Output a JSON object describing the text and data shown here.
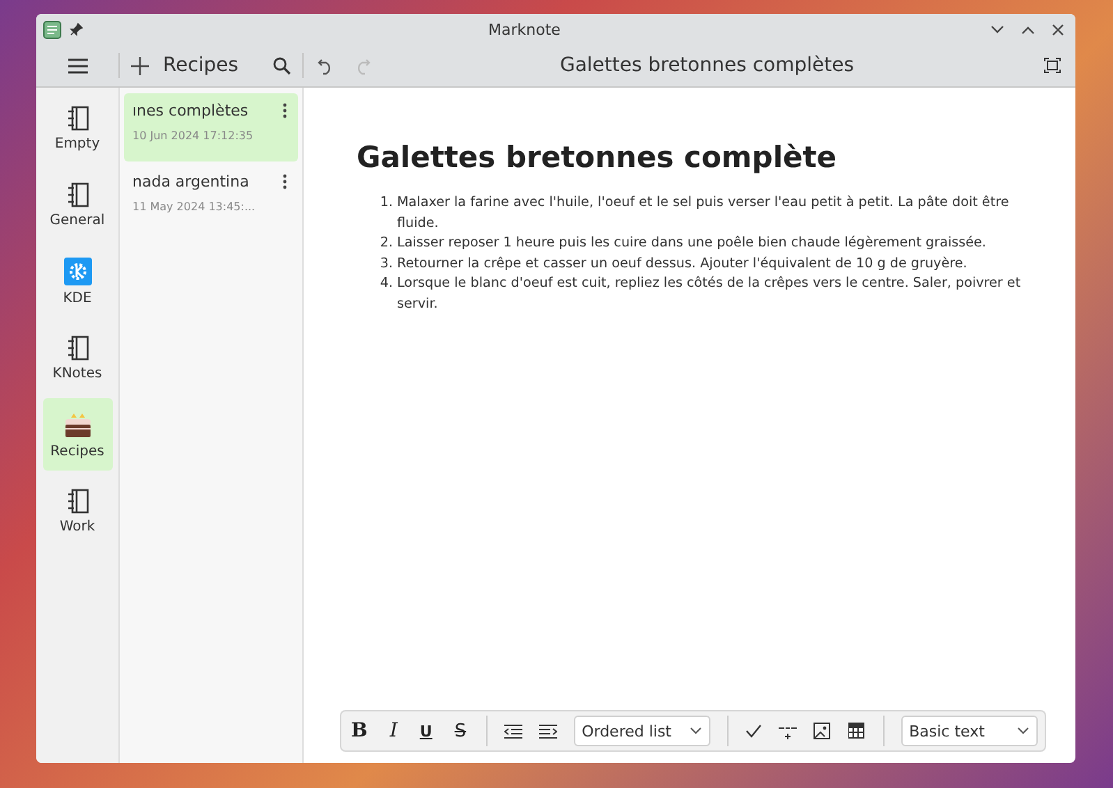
{
  "window": {
    "title": "Marknote"
  },
  "header": {
    "notebook_title": "Recipes",
    "note_title": "Galettes bretonnes complètes"
  },
  "notebooks": [
    {
      "name": "Empty",
      "kind": "notebook",
      "selected": false
    },
    {
      "name": "General",
      "kind": "notebook",
      "selected": false
    },
    {
      "name": "KDE",
      "kind": "kde",
      "selected": false
    },
    {
      "name": "KNotes",
      "kind": "notebook",
      "selected": false
    },
    {
      "name": "Recipes",
      "kind": "cake",
      "selected": true
    },
    {
      "name": "Work",
      "kind": "notebook",
      "selected": false
    }
  ],
  "notes": [
    {
      "title": "ınes complètes",
      "date": "10 Jun 2024 17:12:35",
      "selected": true
    },
    {
      "title": "nada argentina",
      "date": "11 May 2024 13:45:...",
      "selected": false
    }
  ],
  "editor": {
    "heading": "Galettes bretonnes complète",
    "steps": [
      {
        "marker": "1.",
        "text": "Malaxer la farine avec l'huile, l'oeuf et le sel puis verser l'eau petit à petit. La pâte doit être fluide."
      },
      {
        "marker": "2.",
        "text": "Laisser reposer 1 heure puis les cuire dans une poêle bien chaude légèrement graissée."
      },
      {
        "marker": "3.",
        "text": "Retourner la crêpe et casser un oeuf dessus. Ajouter l'équivalent de 10 g de gruyère."
      },
      {
        "marker": "4.",
        "text": "Lorsque le blanc d'oeuf est cuit, repliez les côtés de la crêpes vers le centre. Saler, poivrer et servir."
      }
    ]
  },
  "toolbar": {
    "format_buttons": [
      "B",
      "I",
      "U",
      "S"
    ],
    "list_style": "Ordered list",
    "text_style": "Basic text"
  }
}
